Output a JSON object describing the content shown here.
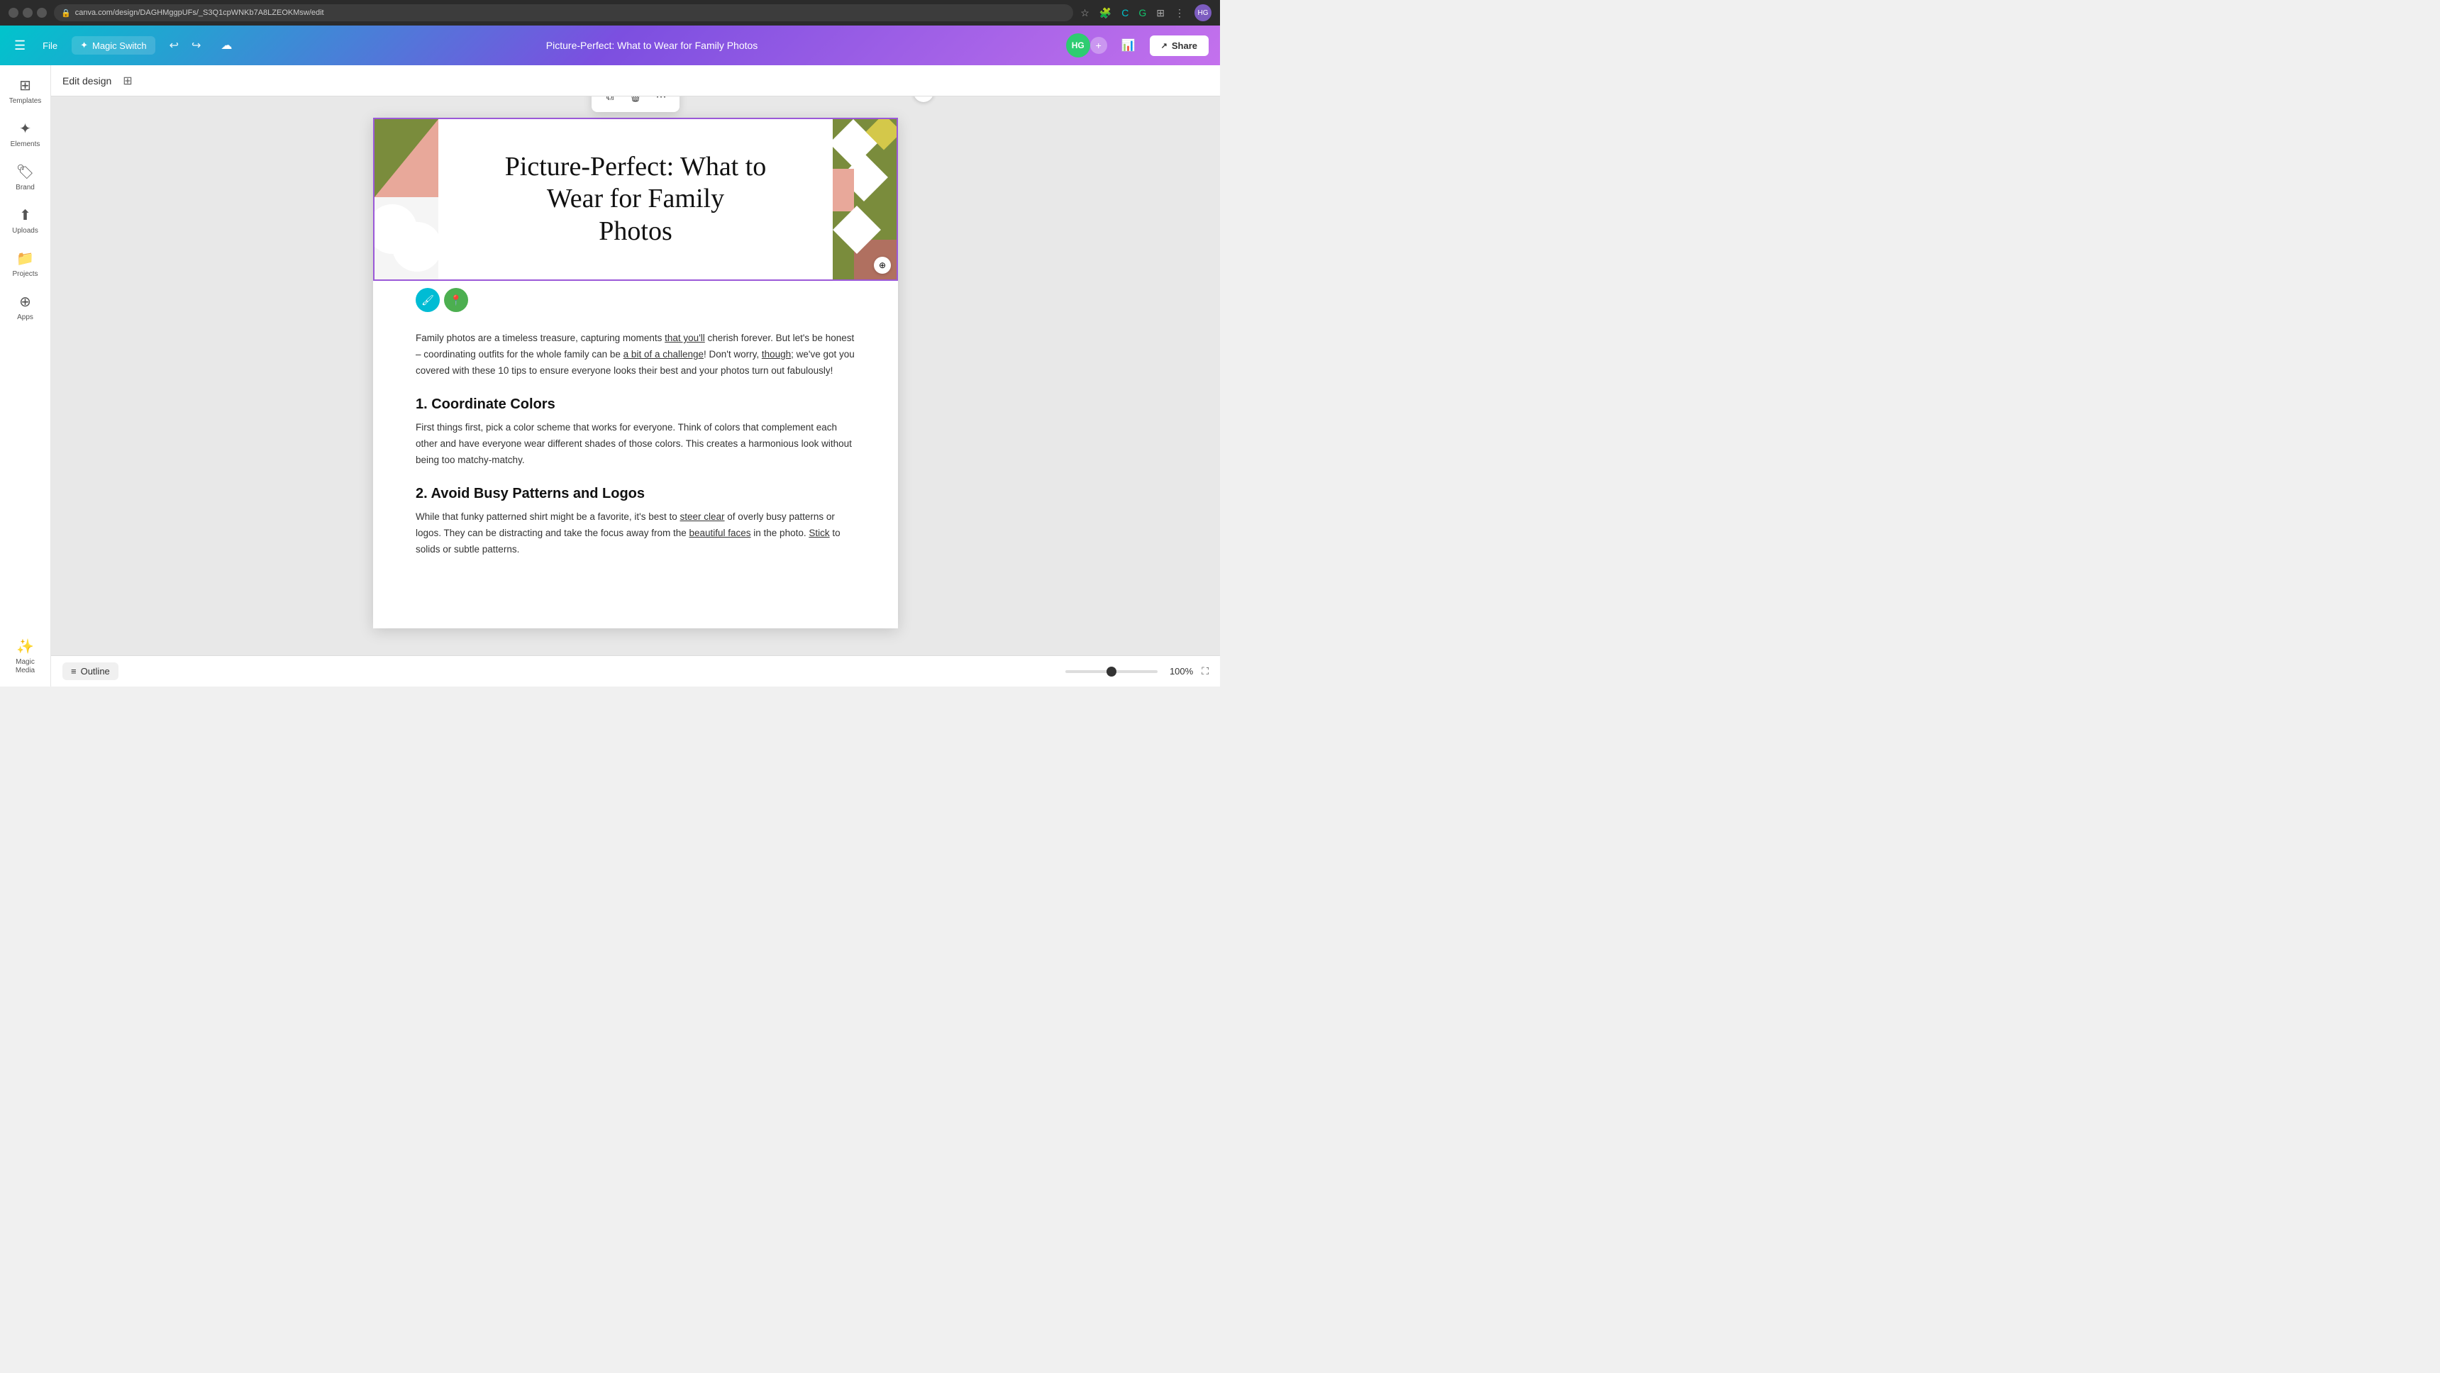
{
  "browser": {
    "url": "canva.com/design/DAGHMggpUFs/_S3Q1cpWNKb7A8LZEOKMsw/edit",
    "back_btn": "←",
    "forward_btn": "→",
    "refresh_btn": "↻",
    "profile_initials": "HG"
  },
  "appbar": {
    "menu_icon": "☰",
    "file_label": "File",
    "magic_switch_label": "Magic Switch",
    "magic_icon": "✦",
    "undo_icon": "↩",
    "redo_icon": "↪",
    "cloud_icon": "☁",
    "design_title": "Picture-Perfect: What to Wear for Family Photos",
    "hg_initials": "HG",
    "add_icon": "+",
    "stats_icon": "📊",
    "share_icon": "↗",
    "share_label": "Share"
  },
  "sidebar": {
    "items": [
      {
        "id": "templates",
        "icon": "⊞",
        "label": "Templates"
      },
      {
        "id": "elements",
        "icon": "✦",
        "label": "Elements"
      },
      {
        "id": "brand",
        "icon": "🏷",
        "label": "Brand"
      },
      {
        "id": "uploads",
        "icon": "⬆",
        "label": "Uploads"
      },
      {
        "id": "projects",
        "icon": "📁",
        "label": "Projects"
      },
      {
        "id": "apps",
        "icon": "⊕",
        "label": "Apps"
      },
      {
        "id": "magic-media",
        "icon": "✨",
        "label": "Magic Media"
      }
    ]
  },
  "edit_bar": {
    "label": "Edit design",
    "grid_icon": "⊞"
  },
  "floating_toolbar": {
    "copy_icon": "⧉",
    "delete_icon": "🗑",
    "more_icon": "⋯"
  },
  "header": {
    "script_line1": "Picture-Perfect: What to",
    "script_line2": "Wear for Family",
    "script_line3": "Photos"
  },
  "edit_tools": {
    "paint_icon": "🖌",
    "location_icon": "📍"
  },
  "article": {
    "intro": "Family photos are a timeless treasure, capturing moments that you'll cherish forever. But let's be honest – coordinating outfits for the whole family can be a bit of a challenge! Don't worry, though; we've got you covered with these 10 tips to ensure everyone looks their best and your photos turn out fabulously!",
    "intro_underlined1": "that you'll",
    "intro_underlined2": "a bit of a challenge",
    "intro_underlined3": "though",
    "section1_heading": "1. Coordinate Colors",
    "section1_body": "First things first, pick a color scheme that works for everyone. Think of colors that complement each other and have everyone wear different shades of those colors. This creates a harmonious look without being too matchy-matchy.",
    "section2_heading": "2. Avoid Busy Patterns and Logos",
    "section2_body": "While that funky patterned shirt might be a favorite, it's best to steer clear of overly busy patterns or logos. They can be distracting and take the focus away from the beautiful faces in the photo. Stick to solids or subtle patterns.",
    "section2_underlined1": "steer clear",
    "section2_underlined2": "beautiful faces",
    "section2_underlined3": "Stick"
  },
  "bottom_bar": {
    "outline_icon": "≡",
    "outline_label": "Outline",
    "zoom_percent": "100%",
    "fullscreen_icon": "⛶"
  },
  "colors": {
    "accent_purple": "#9b59d8",
    "accent_teal": "#00bcd4",
    "geo_pink": "#e8a89a",
    "geo_green": "#7a8c3c",
    "geo_yellow": "#d4c84a",
    "geo_brown": "#b07060"
  }
}
